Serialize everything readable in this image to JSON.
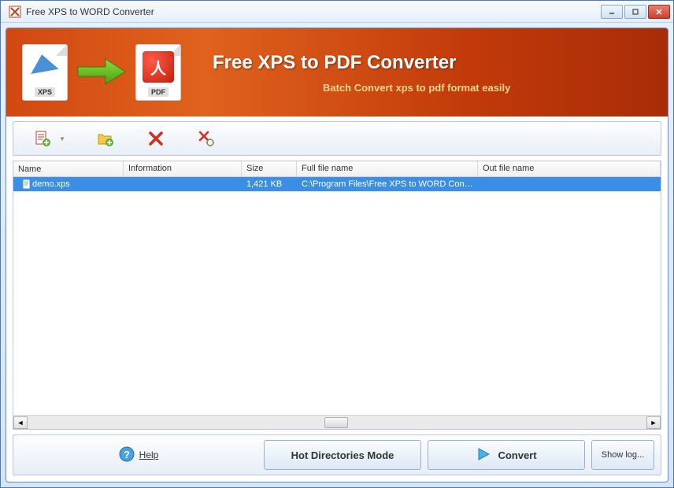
{
  "window": {
    "title": "Free XPS to WORD Converter"
  },
  "banner": {
    "title": "Free XPS to PDF Converter",
    "subtitle": "Batch Convert  xps to pdf format easily",
    "xps_label": "XPS",
    "pdf_label": "PDF"
  },
  "columns": {
    "name": "Name",
    "information": "Information",
    "size": "Size",
    "full_file_name": "Full file name",
    "out_file_name": "Out file name"
  },
  "rows": [
    {
      "name": "demo.xps",
      "information": "",
      "size": "1,421 KB",
      "full_file_name": "C:\\Program Files\\Free XPS to WORD Conv...",
      "out_file_name": ""
    }
  ],
  "buttons": {
    "help": "Help",
    "hot_directories": "Hot Directories Mode",
    "convert": "Convert",
    "show_log": "Show log..."
  },
  "icons": {
    "add_file": "add-file",
    "add_folder": "add-folder",
    "remove": "remove",
    "remove_config": "remove-config"
  }
}
